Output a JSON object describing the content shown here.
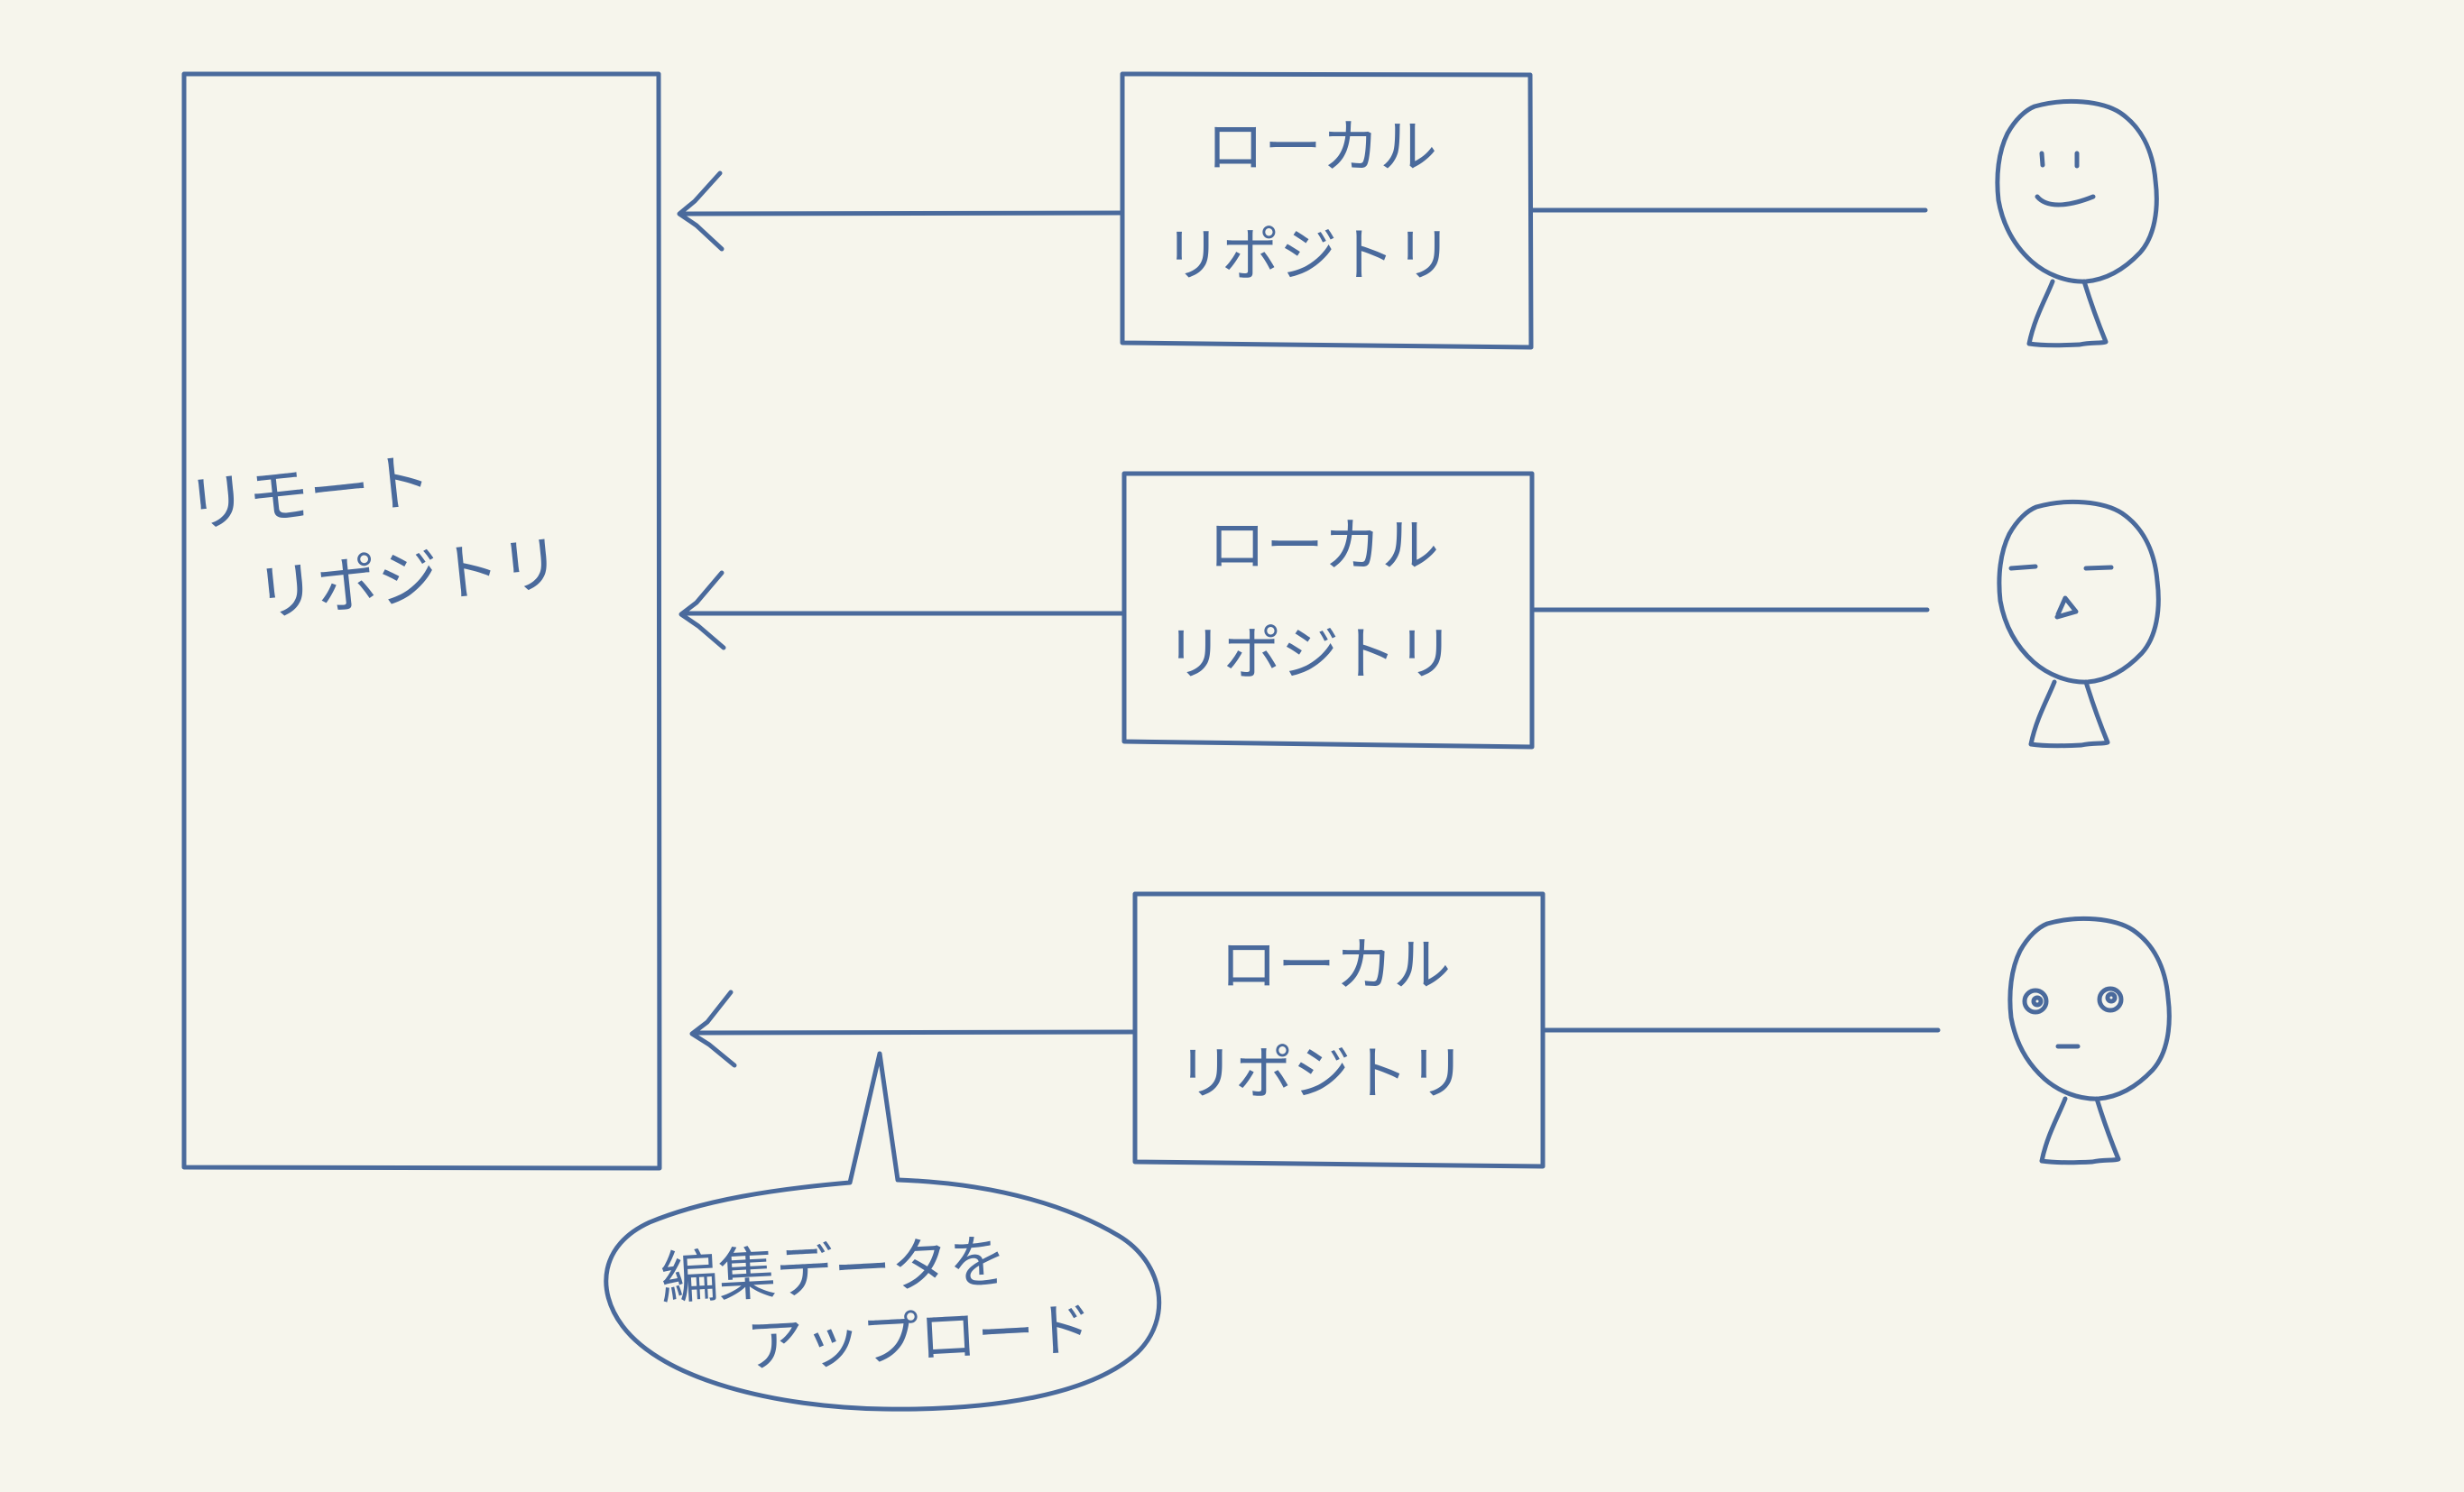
{
  "diagram": {
    "remote": {
      "line1": "リモート",
      "line2": "リポジトリ"
    },
    "locals": [
      {
        "line1": "ローカル",
        "line2": "リポジトリ"
      },
      {
        "line1": "ローカル",
        "line2": "リポジトリ"
      },
      {
        "line1": "ローカル",
        "line2": "リポジトリ"
      }
    ],
    "users": [
      {
        "face": "smiling"
      },
      {
        "face": "bored"
      },
      {
        "face": "surprised"
      }
    ],
    "callout": {
      "line1": "編集データを",
      "line2": "アップロード"
    }
  },
  "colors": {
    "background": "#f6f5ec",
    "ink": "#4a6a9c"
  }
}
